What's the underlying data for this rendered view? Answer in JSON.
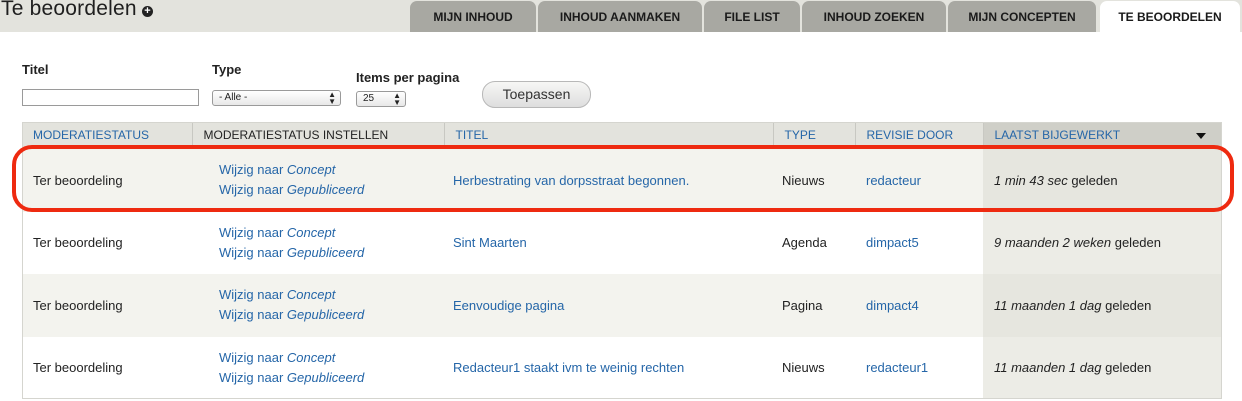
{
  "page": {
    "title": "Te beoordelen",
    "add_icon": "plus-circle-icon"
  },
  "tabs": [
    {
      "label": "Mijn inhoud",
      "active": false
    },
    {
      "label": "Inhoud aanmaken",
      "active": false
    },
    {
      "label": "File list",
      "active": false
    },
    {
      "label": "Inhoud zoeken",
      "active": false
    },
    {
      "label": "Mijn concepten",
      "active": false
    },
    {
      "label": "Te beoordelen",
      "active": true
    }
  ],
  "filters": {
    "title_label": "Titel",
    "title_value": "",
    "type_label": "Type",
    "type_selected": "- Alle -",
    "items_label": "Items per pagina",
    "items_selected": "25",
    "apply_label": "Toepassen"
  },
  "table": {
    "columns": [
      "Moderatiestatus",
      "Moderatiestatus instellen",
      "Titel",
      "Type",
      "Revisie door",
      "Laatst bijgewerkt"
    ],
    "sort_icon": "sort-descending-icon",
    "action_prefix": "Wijzig naar",
    "action_concept": "Concept",
    "action_published": "Gepubliceerd",
    "rows": [
      {
        "status": "Ter beoordeling",
        "title": "Herbestrating van dorpsstraat begonnen.",
        "type": "Nieuws",
        "user": "redacteur",
        "updated_em": "1 min 43 sec",
        "updated_suffix": "geleden"
      },
      {
        "status": "Ter beoordeling",
        "title": "Sint Maarten",
        "type": "Agenda",
        "user": "dimpact5",
        "updated_em": "9 maanden 2 weken",
        "updated_suffix": "geleden"
      },
      {
        "status": "Ter beoordeling",
        "title": "Eenvoudige pagina",
        "type": "Pagina",
        "user": "dimpact4",
        "updated_em": "11 maanden 1 dag",
        "updated_suffix": "geleden"
      },
      {
        "status": "Ter beoordeling",
        "title": "Redacteur1 staakt ivm te weinig rechten",
        "type": "Nieuws",
        "user": "redacteur1",
        "updated_em": "11 maanden 1 dag",
        "updated_suffix": "geleden"
      }
    ]
  },
  "colors": {
    "link": "#2566a8",
    "highlight": "#ee2a10",
    "tab_inactive": "#a8a8a2",
    "header_bg": "#e3e3dd"
  }
}
